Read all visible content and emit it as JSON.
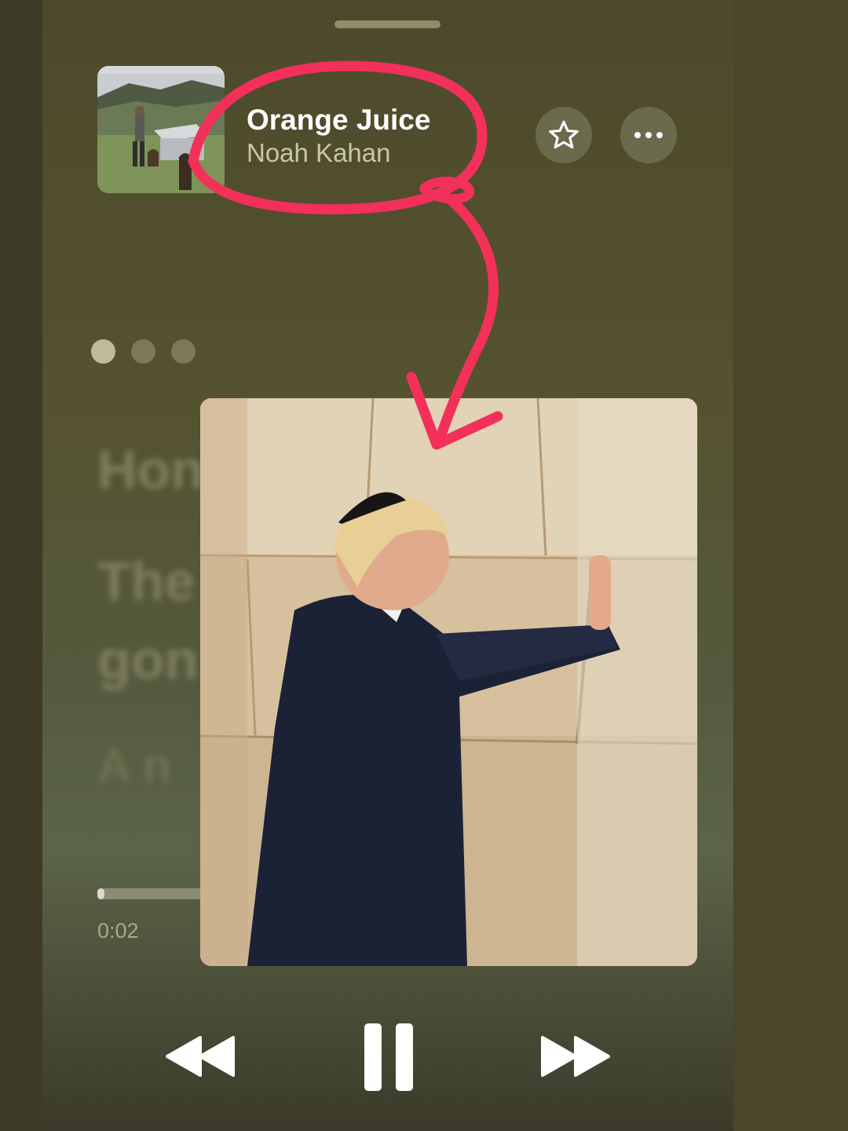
{
  "now_playing": {
    "title": "Orange Juice",
    "artist": "Noah Kahan"
  },
  "icons": {
    "favorite": "star-icon",
    "more": "ellipsis-icon",
    "rewind": "backward-icon",
    "pause": "pause-icon",
    "forward": "forward-icon"
  },
  "page_indicator": {
    "count": 3,
    "active_index": 0
  },
  "lyrics_blurred": [
    "Hon",
    "The",
    "gon",
    "A n",
    ""
  ],
  "playback": {
    "elapsed": "0:02",
    "progress_fraction": 0.007
  },
  "colors": {
    "annotation": "#f2305a",
    "background": "#55522f",
    "text_primary": "#ffffff",
    "text_secondary": "#c9c7a9"
  }
}
